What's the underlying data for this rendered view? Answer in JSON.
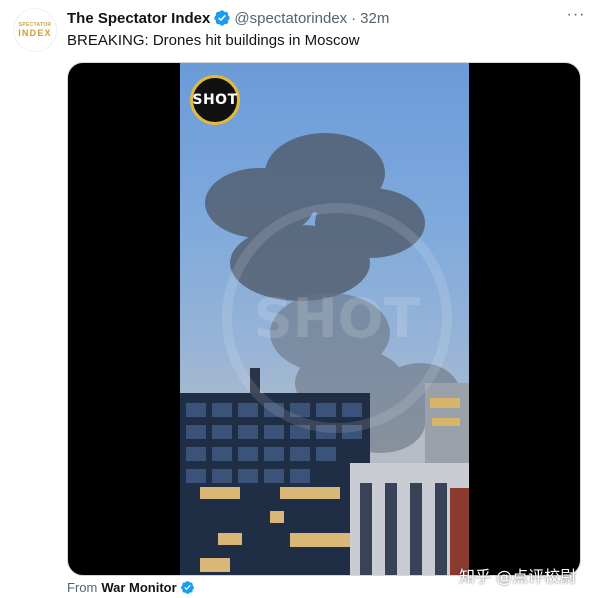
{
  "author": {
    "avatar_top": "SPECTATOR",
    "avatar_bottom": "INDEX",
    "display_name": "The Spectator Index",
    "handle": "@spectatorindex",
    "separator": "·",
    "time": "32m"
  },
  "more_label": "···",
  "tweet": {
    "text": "BREAKING: Drones hit buildings in Moscow"
  },
  "media": {
    "badge_text": "SHOT",
    "watermark_text": "SHOT"
  },
  "footer": {
    "from_label": "From",
    "from_name": "War Monitor"
  },
  "overlay_watermark": "知乎 @点评校尉",
  "colors": {
    "verified": "#1d9bf0",
    "text_primary": "#0f1419",
    "text_secondary": "#536471",
    "shot_ring": "#e3b93a"
  }
}
